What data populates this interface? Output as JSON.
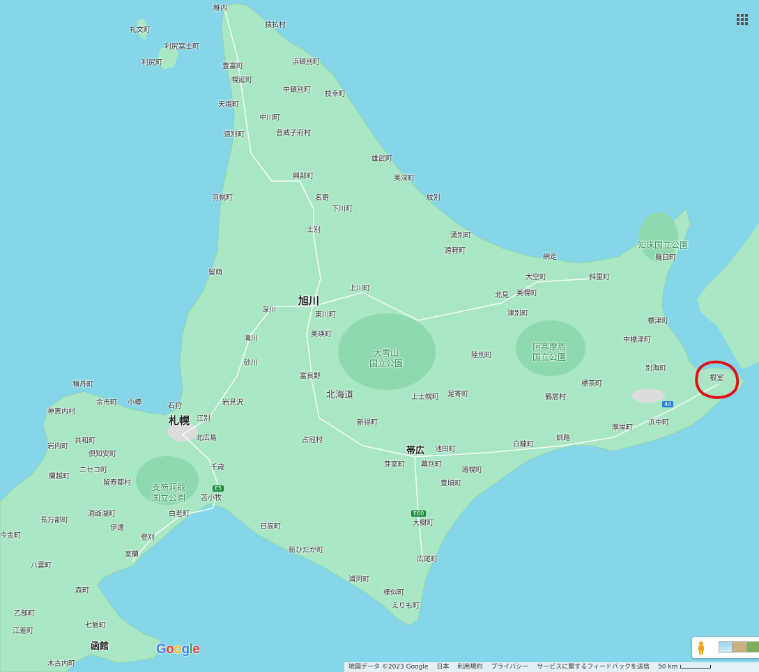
{
  "map": {
    "places": [
      {
        "name": "稚内",
        "kind": "town"
      },
      {
        "name": "猿払村",
        "kind": "town"
      },
      {
        "name": "礼文町",
        "kind": "town"
      },
      {
        "name": "利尻富士町",
        "kind": "town"
      },
      {
        "name": "利尻町",
        "kind": "town"
      },
      {
        "name": "浜頓別町",
        "kind": "town"
      },
      {
        "name": "豊富町",
        "kind": "town"
      },
      {
        "name": "幌延町",
        "kind": "town"
      },
      {
        "name": "中頓別町",
        "kind": "town"
      },
      {
        "name": "枝幸町",
        "kind": "town"
      },
      {
        "name": "天塩町",
        "kind": "town"
      },
      {
        "name": "中川町",
        "kind": "town"
      },
      {
        "name": "遠別町",
        "kind": "town"
      },
      {
        "name": "音威子府村",
        "kind": "town"
      },
      {
        "name": "雄武町",
        "kind": "town"
      },
      {
        "name": "美深町",
        "kind": "town"
      },
      {
        "name": "興部町",
        "kind": "town"
      },
      {
        "name": "羽幌町",
        "kind": "town"
      },
      {
        "name": "名寄",
        "kind": "town"
      },
      {
        "name": "下川町",
        "kind": "town"
      },
      {
        "name": "紋別",
        "kind": "town"
      },
      {
        "name": "士別",
        "kind": "town"
      },
      {
        "name": "湧別町",
        "kind": "town"
      },
      {
        "name": "遠軽町",
        "kind": "town"
      },
      {
        "name": "網走",
        "kind": "town"
      },
      {
        "name": "留萌",
        "kind": "town"
      },
      {
        "name": "上川町",
        "kind": "town"
      },
      {
        "name": "大空町",
        "kind": "town"
      },
      {
        "name": "斜里町",
        "kind": "town"
      },
      {
        "name": "羅臼町",
        "kind": "town"
      },
      {
        "name": "北見",
        "kind": "town"
      },
      {
        "name": "美幌町",
        "kind": "town"
      },
      {
        "name": "深川",
        "kind": "town"
      },
      {
        "name": "旭川",
        "kind": "city"
      },
      {
        "name": "東川町",
        "kind": "town"
      },
      {
        "name": "津別町",
        "kind": "town"
      },
      {
        "name": "標津町",
        "kind": "town"
      },
      {
        "name": "美瑛町",
        "kind": "town"
      },
      {
        "name": "滝川",
        "kind": "town"
      },
      {
        "name": "中標津町",
        "kind": "town"
      },
      {
        "name": "陸別町",
        "kind": "town"
      },
      {
        "name": "砂川",
        "kind": "town"
      },
      {
        "name": "別海町",
        "kind": "town"
      },
      {
        "name": "富良野",
        "kind": "town"
      },
      {
        "name": "根室",
        "kind": "town"
      },
      {
        "name": "積丹町",
        "kind": "town"
      },
      {
        "name": "標茶町",
        "kind": "town"
      },
      {
        "name": "余市町",
        "kind": "town"
      },
      {
        "name": "小樽",
        "kind": "town"
      },
      {
        "name": "上士幌町",
        "kind": "town"
      },
      {
        "name": "足寄町",
        "kind": "town"
      },
      {
        "name": "石狩",
        "kind": "town"
      },
      {
        "name": "岩見沢",
        "kind": "town"
      },
      {
        "name": "鶴居村",
        "kind": "town"
      },
      {
        "name": "神恵内村",
        "kind": "town"
      },
      {
        "name": "札幌",
        "kind": "city"
      },
      {
        "name": "江別",
        "kind": "town"
      },
      {
        "name": "新得町",
        "kind": "town"
      },
      {
        "name": "厚岸町",
        "kind": "town"
      },
      {
        "name": "浜中町",
        "kind": "town"
      },
      {
        "name": "共和町",
        "kind": "town"
      },
      {
        "name": "北広島",
        "kind": "town"
      },
      {
        "name": "占冠村",
        "kind": "town"
      },
      {
        "name": "釧路",
        "kind": "town"
      },
      {
        "name": "岩内町",
        "kind": "town"
      },
      {
        "name": "白糠町",
        "kind": "town"
      },
      {
        "name": "帯広",
        "kind": "city2"
      },
      {
        "name": "倶知安町",
        "kind": "town"
      },
      {
        "name": "池田町",
        "kind": "town"
      },
      {
        "name": "ニセコ町",
        "kind": "town"
      },
      {
        "name": "芽室町",
        "kind": "town"
      },
      {
        "name": "幕別町",
        "kind": "town"
      },
      {
        "name": "千歳",
        "kind": "town"
      },
      {
        "name": "蘭越町",
        "kind": "town"
      },
      {
        "name": "留寿都村",
        "kind": "town"
      },
      {
        "name": "浦幌町",
        "kind": "town"
      },
      {
        "name": "豊頃町",
        "kind": "town"
      },
      {
        "name": "苫小牧",
        "kind": "town"
      },
      {
        "name": "洞爺湖町",
        "kind": "town"
      },
      {
        "name": "白老町",
        "kind": "town"
      },
      {
        "name": "長万部町",
        "kind": "town"
      },
      {
        "name": "大樹町",
        "kind": "town"
      },
      {
        "name": "伊達",
        "kind": "town"
      },
      {
        "name": "日高町",
        "kind": "town"
      },
      {
        "name": "今金町",
        "kind": "town"
      },
      {
        "name": "登別",
        "kind": "town"
      },
      {
        "name": "室蘭",
        "kind": "town"
      },
      {
        "name": "新ひだか町",
        "kind": "town"
      },
      {
        "name": "八雲町",
        "kind": "town"
      },
      {
        "name": "広尾町",
        "kind": "town"
      },
      {
        "name": "浦河町",
        "kind": "town"
      },
      {
        "name": "森町",
        "kind": "town"
      },
      {
        "name": "様似町",
        "kind": "town"
      },
      {
        "name": "えりも町",
        "kind": "town"
      },
      {
        "name": "乙部町",
        "kind": "town"
      },
      {
        "name": "七飯町",
        "kind": "town"
      },
      {
        "name": "江差町",
        "kind": "town"
      },
      {
        "name": "函館",
        "kind": "city2"
      },
      {
        "name": "木古内町",
        "kind": "town"
      }
    ],
    "region_label": "北海道",
    "parks": [
      {
        "line1": "知床国立公園",
        "line2": ""
      },
      {
        "line1": "阿寒摩周",
        "line2": "国立公園"
      },
      {
        "line1": "大雪山",
        "line2": "国立公園"
      },
      {
        "line1": "支笏洞爺",
        "line2": "国立公園"
      }
    ],
    "routes": [
      "44",
      "E5",
      "E60"
    ],
    "annotation_color": "#e0101a",
    "land_color": "#a8e6c4",
    "sea_color": "#84d6e8"
  },
  "controls": {
    "apps_icon": "apps-grid-icon",
    "pegman_icon": "pegman-icon",
    "logo": "Google"
  },
  "footer": {
    "data": "地図データ ©2023 Google",
    "country": "日本",
    "terms": "利用規約",
    "privacy": "プライバシー",
    "feedback": "サービスに関するフィードバックを送信",
    "scale": "50 km"
  }
}
